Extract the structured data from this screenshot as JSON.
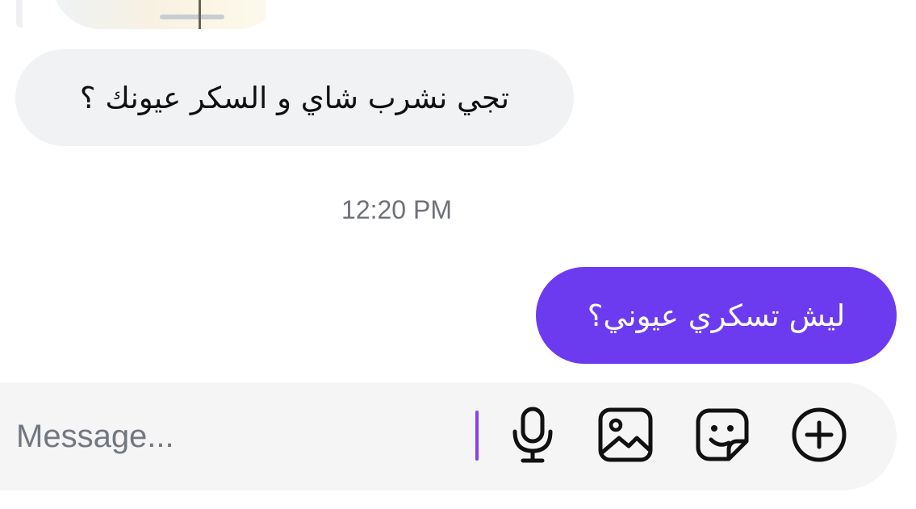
{
  "conversation": {
    "received_message": "تجي نشرب شاي و السكر عيونك ؟",
    "timestamp": "12:20 PM",
    "sent_message": "ليش تسكري عيوني؟"
  },
  "composer": {
    "placeholder": "Message...",
    "icons": [
      "microphone-icon",
      "image-icon",
      "sticker-icon",
      "plus-circle-icon"
    ]
  },
  "colors": {
    "sent_bubble": "#6c3bef",
    "received_bubble": "#f1f2f4",
    "caret": "#8a3ff0",
    "composer_background": "#f5f5f6"
  }
}
